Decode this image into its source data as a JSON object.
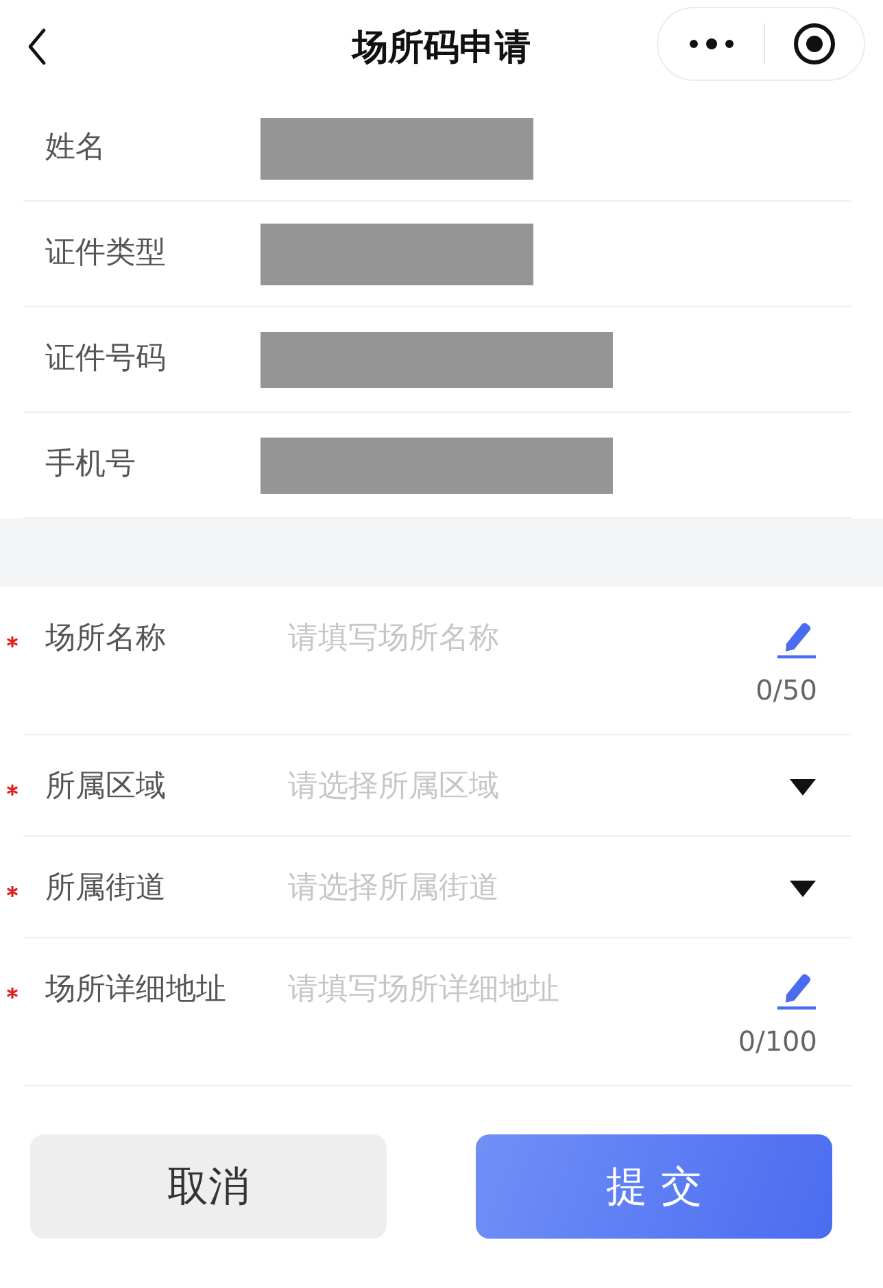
{
  "nav_bar": {
    "title": "场所码申请"
  },
  "applicant_info": [
    {
      "label": "姓名",
      "redacted": true,
      "long_value": false
    },
    {
      "label": "证件类型",
      "redacted": true,
      "long_value": false
    },
    {
      "label": "证件号码",
      "redacted": true,
      "long_value": true
    },
    {
      "label": "手机号",
      "redacted": true,
      "long_value": true
    }
  ],
  "form_fields": [
    {
      "label": "场所名称",
      "required": true,
      "kind": "text",
      "placeholder": "请填写场所名称",
      "counter": "0/50"
    },
    {
      "label": "所属区域",
      "required": true,
      "kind": "select",
      "placeholder": "请选择所属区域"
    },
    {
      "label": "所属街道",
      "required": true,
      "kind": "select",
      "placeholder": "请选择所属街道"
    },
    {
      "label": "场所详细地址",
      "required": true,
      "kind": "text",
      "placeholder": "请填写场所详细地址",
      "counter": "0/100"
    }
  ],
  "buttons": [
    {
      "label": "取消",
      "kind": "secondary"
    },
    {
      "label": "提 交",
      "kind": "primary"
    }
  ]
}
